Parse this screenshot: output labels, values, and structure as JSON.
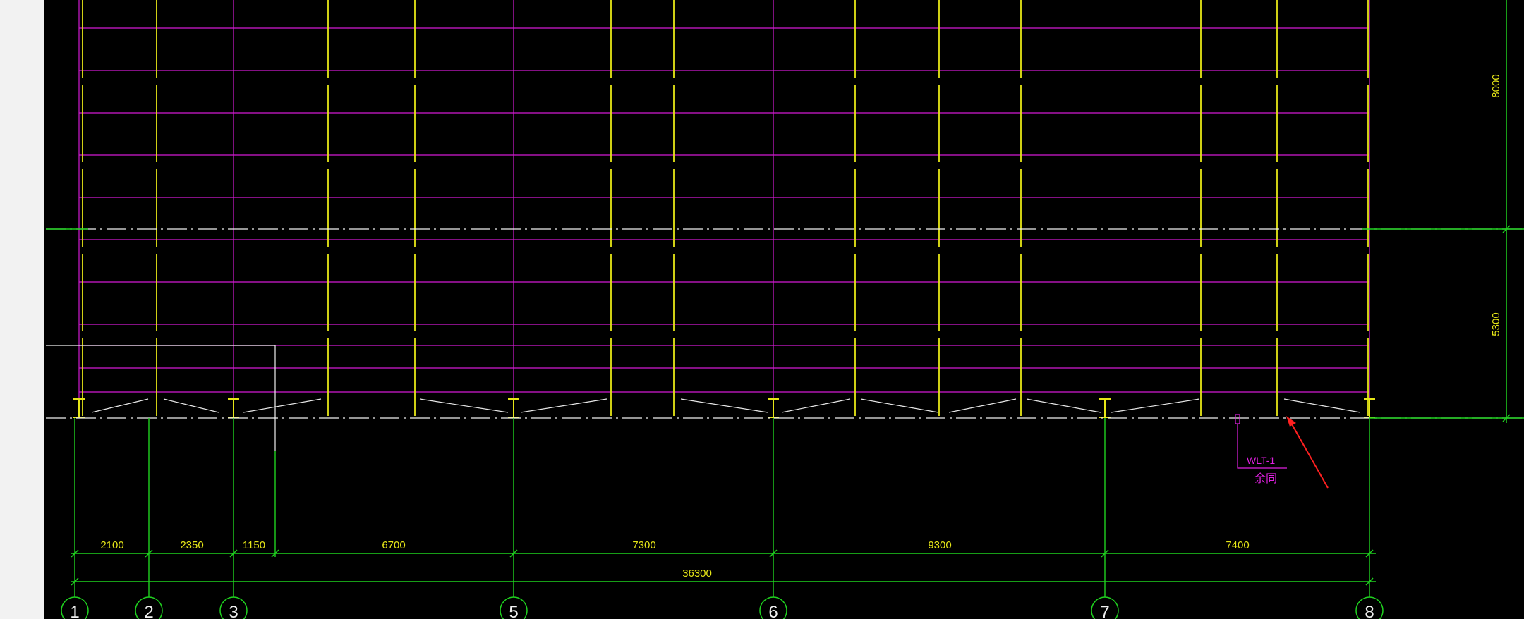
{
  "colors": {
    "background": "#000000",
    "grid_purlin": "#d21ad2",
    "steel_column": "#e6e617",
    "dimension": "#1fd21f",
    "dimension_text": "#e6e617",
    "axis_line": "#f0f0f0",
    "annotation": "#e020e0",
    "arrow": "#ff2020",
    "side_panel": "#f2f2f2"
  },
  "grid_axes": [
    {
      "label": "1"
    },
    {
      "label": "2"
    },
    {
      "label": "3"
    },
    {
      "label": "5"
    },
    {
      "label": "6"
    },
    {
      "label": "7"
    },
    {
      "label": "8"
    }
  ],
  "bay_dimensions": [
    "2100",
    "2350",
    "1150",
    "6700",
    "7300",
    "9300",
    "7400"
  ],
  "total_dimension": "36300",
  "vertical_dimensions": [
    "8000",
    "5300"
  ],
  "annotation": {
    "tag": "WLT-1",
    "subtext": "余同"
  }
}
